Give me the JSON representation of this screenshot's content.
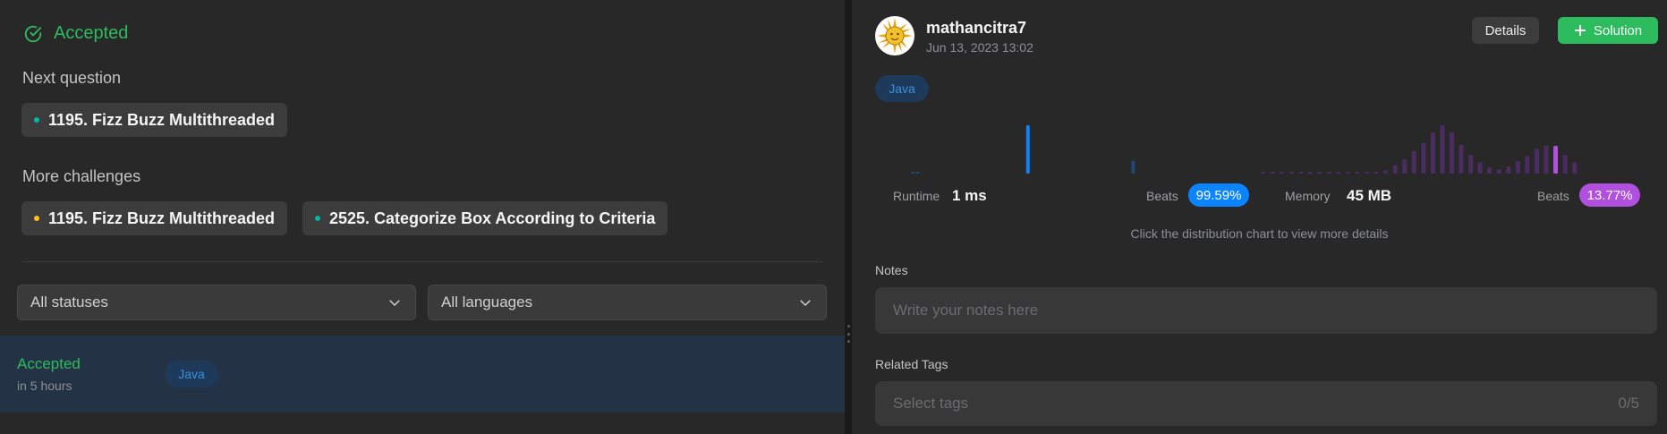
{
  "left": {
    "status": "Accepted",
    "next_question_label": "Next question",
    "next_question": {
      "title": "1195. Fizz Buzz Multithreaded",
      "dot_color": "#00b8a3"
    },
    "more_challenges_label": "More challenges",
    "challenges": [
      {
        "title": "1195. Fizz Buzz Multithreaded",
        "dot_color": "#ffc01e"
      },
      {
        "title": "2525. Categorize Box According to Criteria",
        "dot_color": "#00b8a3"
      }
    ],
    "filters": {
      "statuses": "All statuses",
      "languages": "All languages"
    },
    "submission": {
      "status": "Accepted",
      "time": "in 5 hours",
      "language": "Java"
    }
  },
  "right": {
    "username": "mathancitra7",
    "date": "Jun 13, 2023 13:02",
    "details_label": "Details",
    "solution_label": "Solution",
    "language": "Java",
    "runtime": {
      "label": "Runtime",
      "value": "1 ms",
      "beats_label": "Beats",
      "beats": "99.59%",
      "color": "#0a84ff"
    },
    "memory": {
      "label": "Memory",
      "value": "45 MB",
      "beats_label": "Beats",
      "beats": "13.77%",
      "color": "#b14fde"
    },
    "hint": "Click the distribution chart to view more details",
    "notes_label": "Notes",
    "notes_placeholder": "Write your notes here",
    "tags_label": "Related Tags",
    "tags_placeholder": "Select tags",
    "tags_count": "0/5"
  },
  "chart_data": [
    {
      "type": "bar",
      "title": "",
      "series": [
        {
          "values": [
            1,
            2,
            0,
            0,
            0,
            0,
            0,
            0,
            0,
            0,
            0,
            0,
            0,
            0,
            0,
            0,
            0,
            0,
            0,
            0,
            0,
            0,
            0,
            52,
            0,
            0,
            0,
            0,
            0,
            0,
            0,
            0,
            0,
            0,
            0,
            0,
            0,
            0,
            0,
            0,
            0,
            0,
            0,
            0,
            14
          ]
        }
      ],
      "highlight_index": 23
    },
    {
      "type": "bar",
      "title": "",
      "series": [
        {
          "values": [
            2,
            2,
            2,
            2,
            2,
            2,
            2,
            2,
            2,
            2,
            2,
            2,
            2,
            3,
            8,
            14,
            22,
            30,
            40,
            47,
            40,
            28,
            18,
            11,
            6,
            4,
            7,
            12,
            17,
            24,
            27,
            27,
            18,
            11
          ]
        }
      ],
      "highlight_index": 31
    }
  ]
}
